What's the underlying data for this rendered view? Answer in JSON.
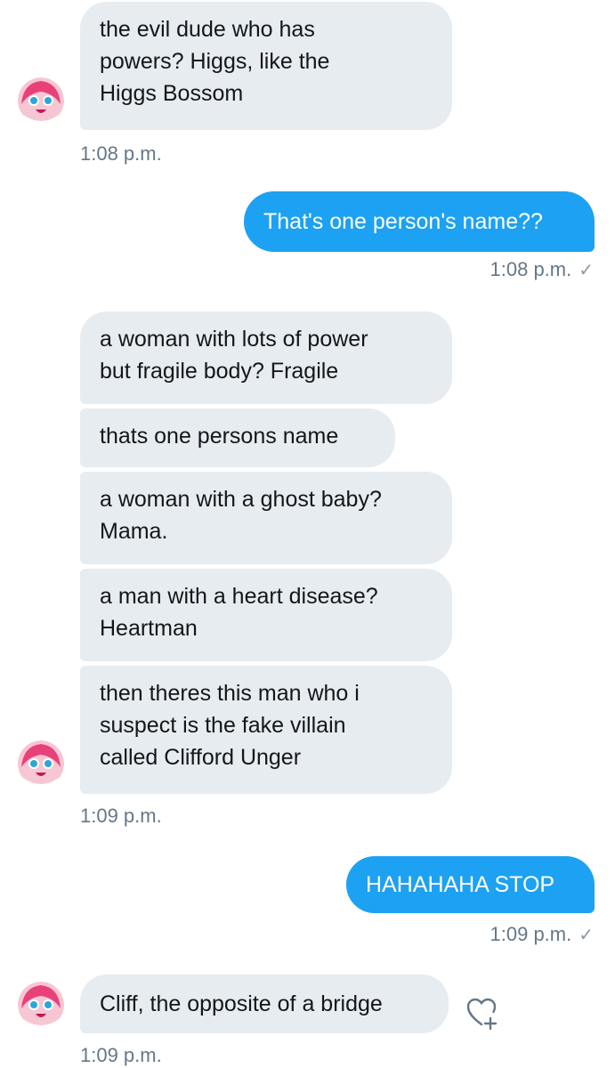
{
  "colors": {
    "incoming_bubble": "#e6ecf0",
    "outgoing_bubble": "#1da1f2",
    "meta_text": "#657786"
  },
  "messages": {
    "m1": "the evil dude who has\npowers? Higgs, like the\nHiggs Bossom",
    "t1": "1:08 p.m.",
    "m2": "That's one person's name??",
    "t2": "1:08 p.m.",
    "m3": "a woman with lots of power\nbut fragile body? Fragile",
    "m4": "thats one persons name",
    "m5": "a woman with a ghost baby?\nMama.",
    "m6": "a man with a heart disease?\nHeartman",
    "m7": "then theres this man who i\nsuspect is the fake villain\ncalled Clifford Unger",
    "t3": "1:09 p.m.",
    "m8": "HAHAHAHA STOP",
    "t4": "1:09 p.m.",
    "m9": "Cliff, the opposite of a bridge",
    "t5": "1:09 p.m."
  },
  "icons": {
    "read_receipt": "checkmark-icon",
    "like": "heart-plus-icon",
    "avatar": "anime-avatar"
  }
}
